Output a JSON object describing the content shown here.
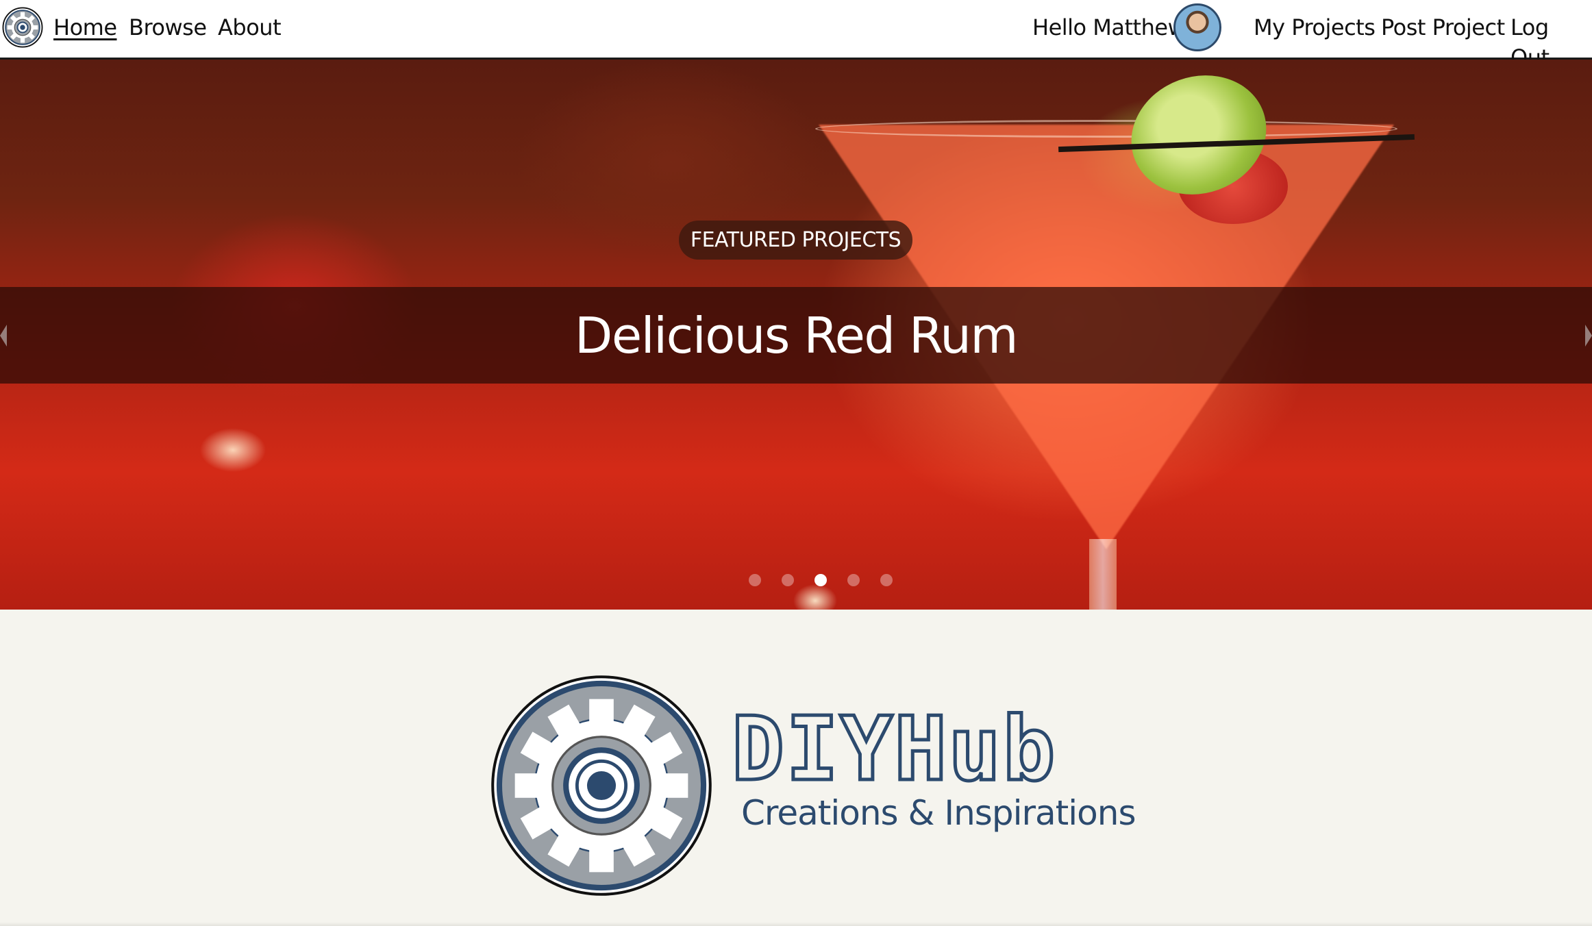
{
  "nav": {
    "home": "Home",
    "browse": "Browse",
    "about": "About",
    "greeting": "Hello Matthew",
    "my_projects": "My Projects",
    "post_project": "Post Project",
    "log_out": "Log Out"
  },
  "hero": {
    "badge": "FEATURED PROJECTS",
    "title": "Delicious Red Rum",
    "slide_count": 5,
    "active_slide": 3
  },
  "brand": {
    "name": "DIYHub",
    "tagline": "Creations & Inspirations"
  },
  "colors": {
    "brand_blue": "#2c4a6e",
    "page_background": "#f5f4ee",
    "nav_background": "#ffffff"
  },
  "icons": {
    "logo": "gear-logo-icon",
    "avatar": "user-avatar",
    "prev": "chevron-left-icon",
    "next": "chevron-right-icon"
  }
}
